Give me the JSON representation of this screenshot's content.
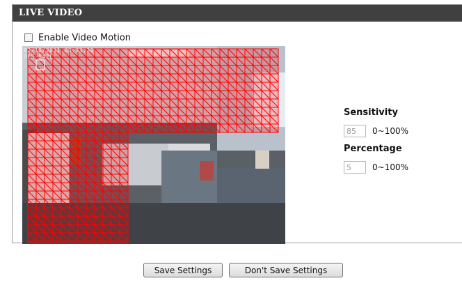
{
  "panel": {
    "title": "LIVE VIDEO",
    "enable_motion_label": "Enable Video Motion",
    "enable_motion_checked": false
  },
  "video": {
    "osd_line1": "02/18/2011 03:33:20",
    "osd_line2": "DCS-942L",
    "grid_color": "#ff0000"
  },
  "settings": {
    "sensitivity": {
      "label": "Sensitivity",
      "value": "85",
      "range": "0~100%"
    },
    "percentage": {
      "label": "Percentage",
      "value": "5",
      "range": "0~100%"
    }
  },
  "buttons": {
    "save": "Save Settings",
    "dont_save": "Don't Save Settings"
  },
  "colors": {
    "header_bg": "#404040",
    "header_text": "#ffffff"
  }
}
